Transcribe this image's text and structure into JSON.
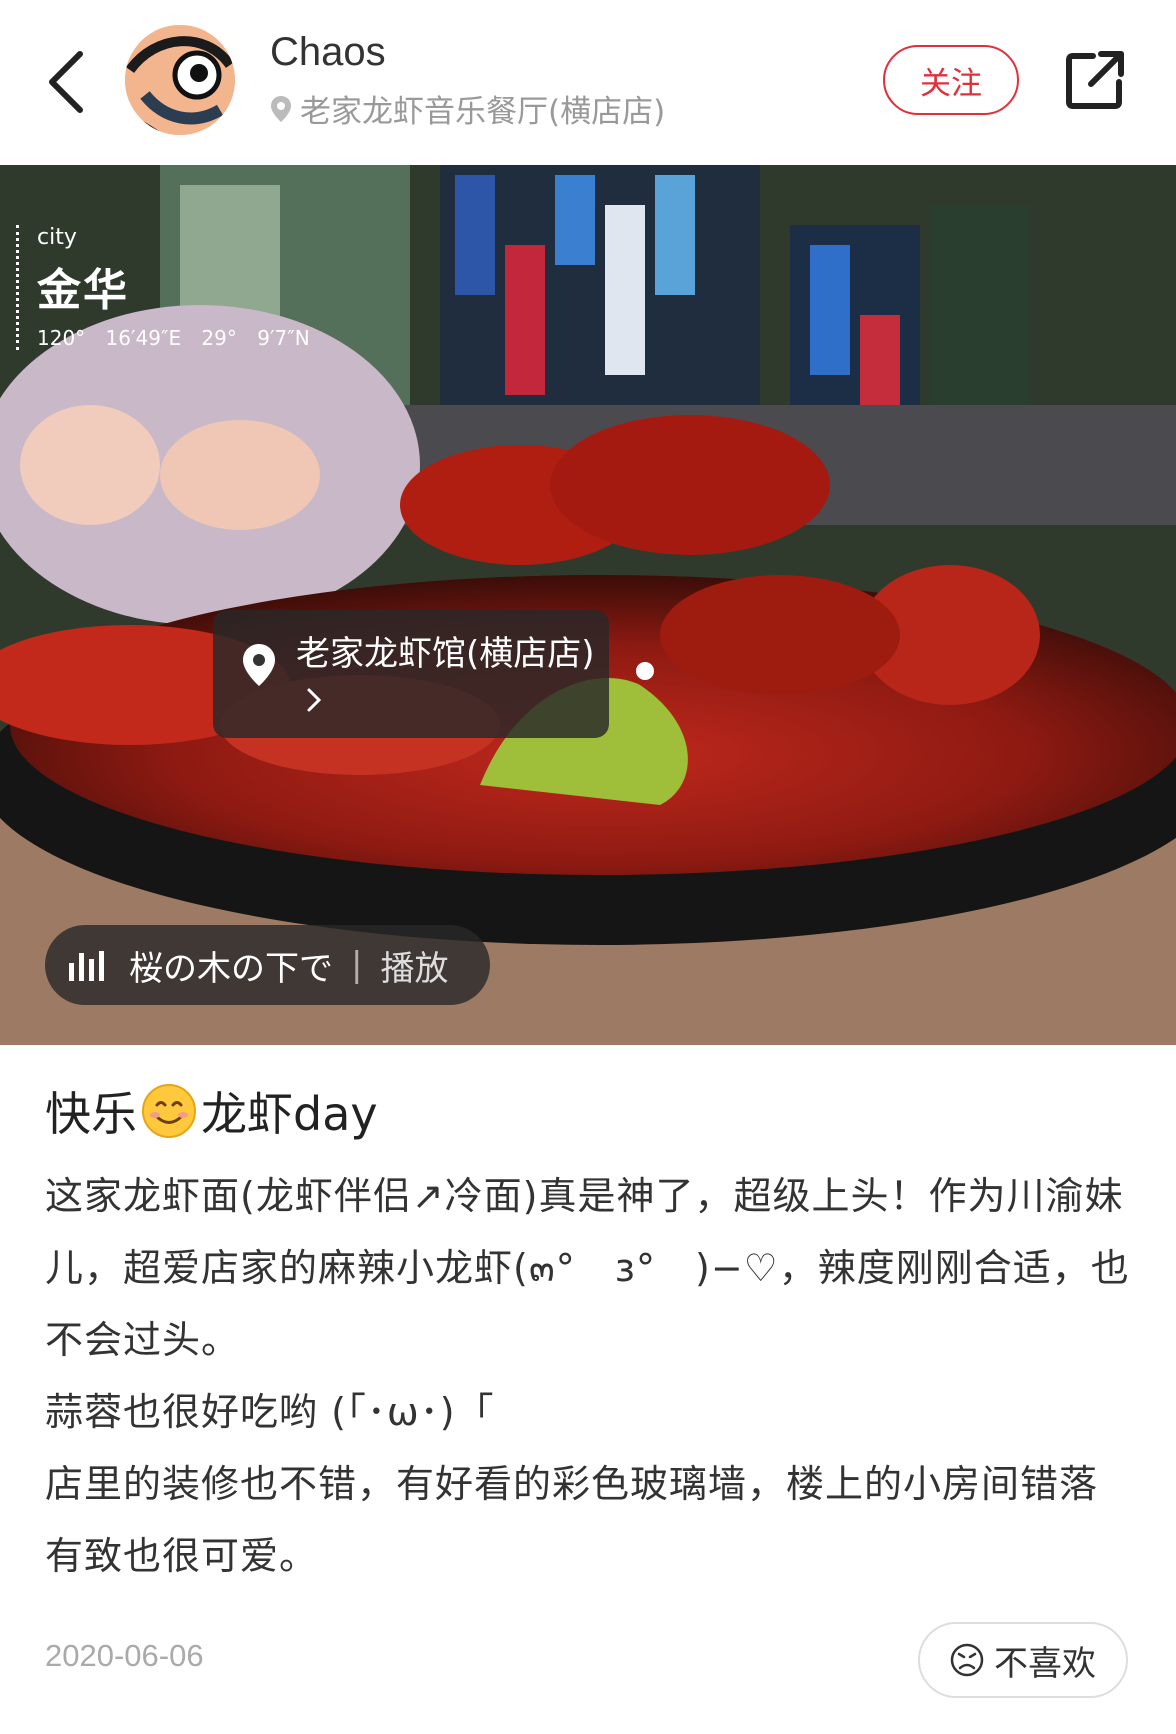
{
  "header": {
    "author": "Chaos",
    "location": "老家龙虾音乐餐厅(横店店)",
    "follow_label": "关注"
  },
  "photo": {
    "city_label": "city",
    "city_name": "金华",
    "coordinates": "120° 16′49″E 29° 9′7″N",
    "poi_tag": "老家龙虾馆(横店店)",
    "music_song": "桜の木の下で",
    "music_play_label": "播放"
  },
  "post": {
    "title_before": "快乐",
    "title_after": "龙虾day",
    "paragraphs": [
      "这家龙虾面(龙虾伴侣↗冷面)真是神了，超级上头！作为川渝妹儿，超爱店家的麻辣小龙虾(๓°　з°　)−♡，辣度刚刚合适，也不会过头。",
      "蒜蓉也很好吃哟 (「･ω･)「",
      "店里的装修也不错，有好看的彩色玻璃墙，楼上的小房间错落有致也很可爱。"
    ],
    "date": "2020-06-06",
    "dislike_label": "不喜欢"
  },
  "colors": {
    "accent": "#e0303d",
    "text_muted": "#999999"
  }
}
